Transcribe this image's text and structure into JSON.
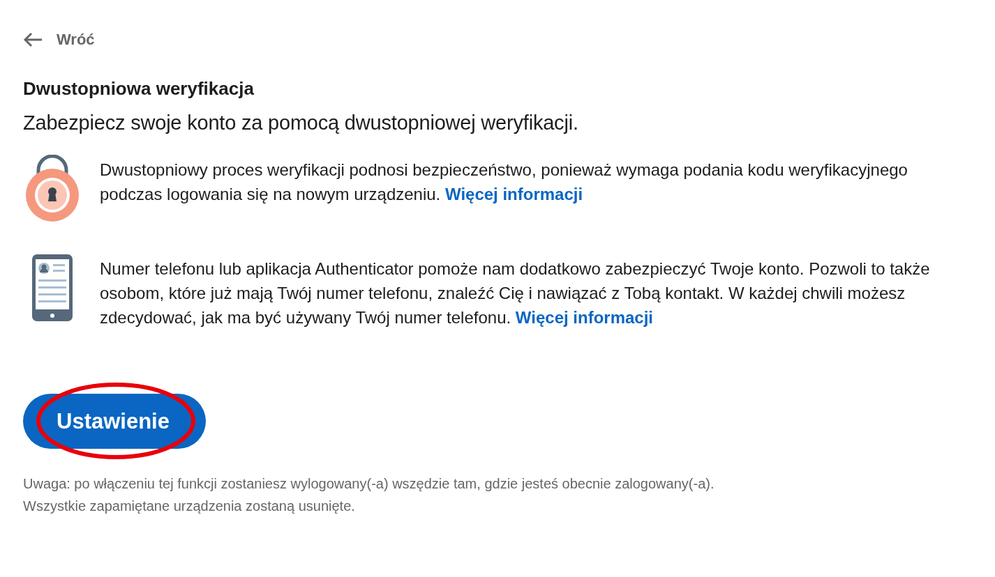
{
  "back": {
    "label": "Wróć"
  },
  "title": "Dwustopniowa weryfikacja",
  "subtitle": "Zabezpiecz swoje konto za pomocą dwustopniowej weryfikacji.",
  "info": [
    {
      "kind": "lock",
      "text": "Dwustopniowy proces weryfikacji podnosi bezpieczeństwo, ponieważ wymaga podania kodu weryfikacyjnego podczas logowania się na nowym urządzeniu.",
      "link": "Więcej informacji"
    },
    {
      "kind": "phone",
      "text": "Numer telefonu lub aplikacja Authenticator pomoże nam dodatkowo zabezpieczyć Twoje konto. Pozwoli to także osobom, które już mają Twój numer telefonu, znaleźć Cię i nawiązać z Tobą kontakt. W każdej chwili możesz zdecydować, jak ma być używany Twój numer telefonu.",
      "link": "Więcej informacji"
    }
  ],
  "button": {
    "label": "Ustawienie",
    "highlighted": true
  },
  "note": [
    "Uwaga: po włączeniu tej funkcji zostaniesz wylogowany(-a) wszędzie tam, gdzie jesteś obecnie zalogowany(-a).",
    "Wszystkie zapamiętane urządzenia zostaną usunięte."
  ]
}
